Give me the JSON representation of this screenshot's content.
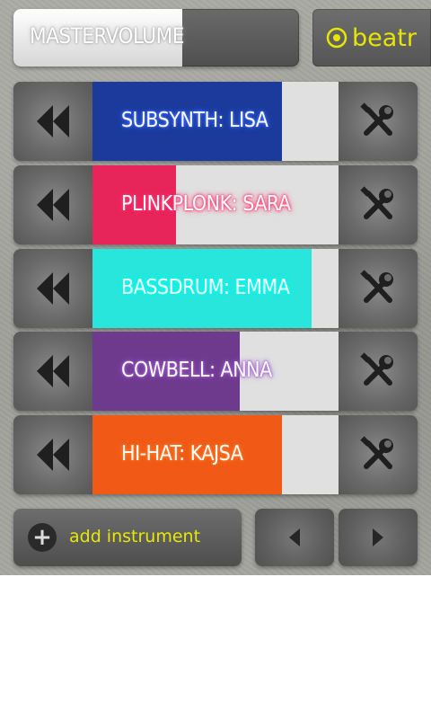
{
  "master": {
    "label": "MASTERVOLUME",
    "level": 0.59
  },
  "brand": {
    "name": "beatr",
    "color": "#e6e600"
  },
  "instruments": [
    {
      "label": "SUBSYNTH: LISA",
      "color": "#1b3a9c",
      "glow": "#3e6bff",
      "level": 0.77
    },
    {
      "label": "PLINKPLONK: SARA",
      "color": "#e8255a",
      "glow": "#ff3a72",
      "level": 0.34
    },
    {
      "label": "BASSDRUM: EMMA",
      "color": "#28e6dc",
      "glow": "#00fff0",
      "level": 0.89
    },
    {
      "label": "COWBELL: ANNA",
      "color": "#6e3a8e",
      "glow": "#a05ed0",
      "level": 0.6
    },
    {
      "label": "HI-HAT: KAJSA",
      "color": "#f05a16",
      "glow": "#ff7a2a",
      "level": 0.77
    }
  ],
  "icons": {
    "rewind": "rewind-icon",
    "settings": "tools-icon",
    "add": "plus-icon",
    "prev": "triangle-left-icon",
    "next": "triangle-right-icon"
  },
  "bottom": {
    "add_label": "add instrument"
  }
}
